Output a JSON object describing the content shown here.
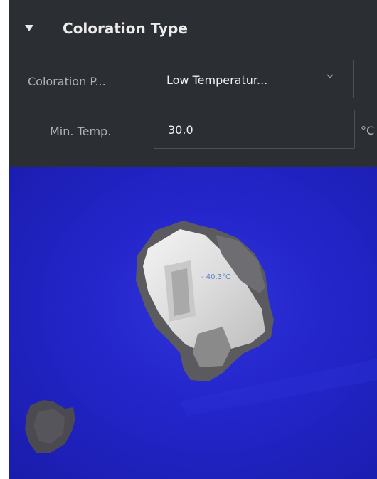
{
  "section": {
    "title": "Coloration Type"
  },
  "palette": {
    "label": "Coloration P...",
    "selected": "Low Temperatur..."
  },
  "min_temp": {
    "label": "Min. Temp.",
    "value": "30.0",
    "unit": "°C"
  },
  "thermal_view": {
    "spot_reading": "- 40.3°C",
    "background_color": "#2325c9"
  },
  "icons": {
    "collapse": "caret-down-icon",
    "dropdown": "chevron-down-icon"
  }
}
